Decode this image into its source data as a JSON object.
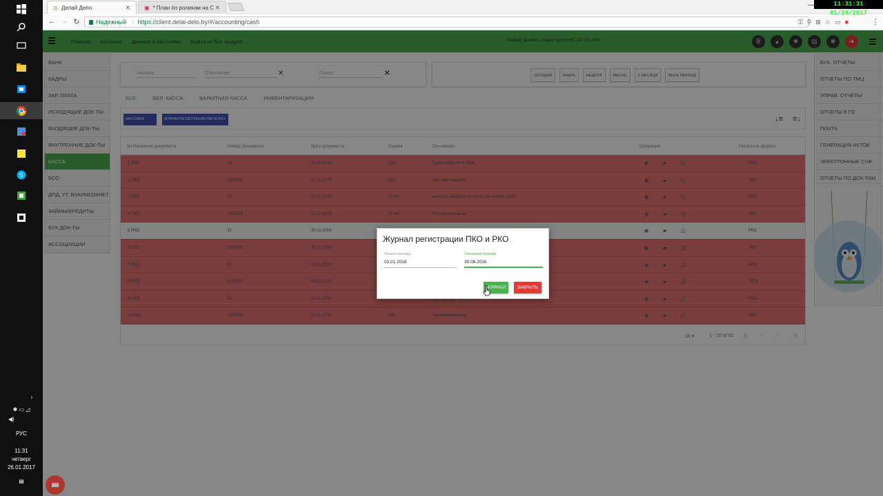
{
  "taskbar": {
    "tray_lang": "РУС",
    "time": "11:31",
    "day": "четверг",
    "date": "26.01.2017"
  },
  "browser": {
    "tabs": [
      {
        "title": "Делай Дело",
        "active": true
      },
      {
        "title": "* План по роликам на С",
        "active": false
      }
    ],
    "overlay_clock": "11:31:31  01/26/2017",
    "secure_label": "Надежный",
    "url_scheme": "https://",
    "url_host": "client.delai-delo.by",
    "url_path": "/#/accounting/cash"
  },
  "app": {
    "header": {
      "menu": [
        "Главная",
        "Каталоги",
        "Данные и настройки",
        "Выйти из бух. модуля"
      ],
      "company": "Райвэр: Дневать скидок групп УНП 192 131 534",
      "icons": [
        "database-icon",
        "user-icon",
        "gear-icon",
        "calculator-icon",
        "bug-icon",
        "logout-icon"
      ]
    },
    "left_menu": [
      {
        "label": "БАНК",
        "active": false
      },
      {
        "label": "КАДРЫ",
        "active": false
      },
      {
        "label": "ЗАР. ПЛАТА",
        "active": false
      },
      {
        "label": "ИСХОДЯЩИЕ ДОК-ТЫ",
        "active": false
      },
      {
        "label": "ВХОДЯЩИЕ ДОК-ТЫ",
        "active": false
      },
      {
        "label": "ВНУТРЕННИЕ ДОК-ТЫ",
        "active": false
      },
      {
        "label": "КАССА",
        "active": true
      },
      {
        "label": "БСО",
        "active": false
      },
      {
        "label": "ДПД, УТ, ВЗАИМОЗАЧЕТ",
        "active": false
      },
      {
        "label": "ЗАЙМЫ/КРЕДИТЫ",
        "active": false
      },
      {
        "label": "БУХ ДОК-ТЫ",
        "active": false
      },
      {
        "label": "АССОЦИАЦИИ",
        "active": false
      }
    ],
    "right_menu": [
      "БУХ. ОТЧЕТЫ",
      "ОТЧЕТЫ ПО ТМЦ",
      "УПРАВ. ОТЧЕТЫ",
      "ОТЧЕТЫ В ГО",
      "ПОЧТА",
      "ГЕНЕРАЦИЯ АКТОВ",
      "ЭЛЕКТРОННЫЕ СЧФ",
      "ОТЧЕТЫ ПО ДОК-ТАМ"
    ],
    "filter": {
      "field1": "Начало",
      "field2": "Окончание",
      "search": "Поиск"
    },
    "periods": [
      "СЕГОДНЯ",
      "ВЧЕРА",
      "НЕДЕЛЯ",
      "МЕСЯЦ",
      "3 МЕСЯЦА",
      "ВЕСЬ ПЕРИОД"
    ],
    "doc_tabs": [
      {
        "label": "ВСЕ",
        "active": true
      },
      {
        "label": "БЕЛ. КАССА",
        "active": false
      },
      {
        "label": "ВАЛЮТНАЯ КАССА",
        "active": false
      },
      {
        "label": "ИНВЕНТАРИЗАЦИЯ",
        "active": false
      }
    ],
    "actions": {
      "btn1": "КАССОВАЯ КНИГА",
      "btn2": "ЖУРНАЛ РЕГИСТРАЦИИ ПКО И РКО"
    },
    "table": {
      "columns": [
        "№ Название документа",
        "Номер документа",
        "Дата документа",
        "Сумма",
        "Основание",
        "Операции",
        "Печатные формы"
      ],
      "rows": [
        {
          "name": "1 РКО",
          "num": "33",
          "date": "30.12.2016",
          "sum": "250",
          "basis": "Сдача выручки в банк",
          "print": "РКО",
          "selected": false
        },
        {
          "name": "2 ПКО",
          "num": "1105022",
          "date": "27.12.2016",
          "sum": "250",
          "basis": "Торговая выручка",
          "print": "ПКО",
          "selected": false
        },
        {
          "name": "3 РКО",
          "num": "32",
          "date": "20.12.2016",
          "sum": "12.64",
          "basis": "выплата заработной платы за ноябрь 2016",
          "print": "РКО",
          "selected": false
        },
        {
          "name": "4 ПКО",
          "num": "1105021",
          "date": "20.12.2016",
          "sum": "12.64",
          "basis": "Торговая выручка",
          "print": "ПКО",
          "selected": false
        },
        {
          "name": "5 РКО",
          "num": "31",
          "date": "30.11.2016",
          "sum": "",
          "basis": "",
          "print": "РКО",
          "selected": true
        },
        {
          "name": "6 ПКО",
          "num": "1105020",
          "date": "30.11.2016",
          "sum": "",
          "basis": "",
          "print": "ПКО",
          "selected": false
        },
        {
          "name": "7 РКО",
          "num": "30",
          "date": "29.11.2016",
          "sum": "",
          "basis": "",
          "print": "РКО",
          "selected": false
        },
        {
          "name": "8 ПКО",
          "num": "1105019",
          "date": "29.11.2016",
          "sum": "",
          "basis": "",
          "print": "ПКО",
          "selected": false
        },
        {
          "name": "9 РКО",
          "num": "29",
          "date": "04.11.2016",
          "sum": "400",
          "basis": "Сдача выручки в банк",
          "print": "РКО",
          "selected": false
        },
        {
          "name": "10 ПКО",
          "num": "1105018",
          "date": "04.11.2016",
          "sum": "400",
          "basis": "Торговая выручка",
          "print": "ПКО",
          "selected": false
        }
      ]
    },
    "pager": {
      "per_page": "10 ▾",
      "range": "1 - 10 of 61"
    }
  },
  "dialog": {
    "title": "Журнал регистрации ПКО и РКО",
    "start_label": "Начало периода",
    "start_value": "01.01.2016",
    "end_label": "Окончание периода",
    "end_value": "30.06.2016",
    "journal_btn": "ЖУРНАЛ",
    "close_btn": "ЗАКРЫТЬ"
  },
  "colors": {
    "accent": "#4caf50",
    "row_red": "#e57373",
    "blue_btn": "#3f51b5",
    "close_red": "#e53935"
  }
}
